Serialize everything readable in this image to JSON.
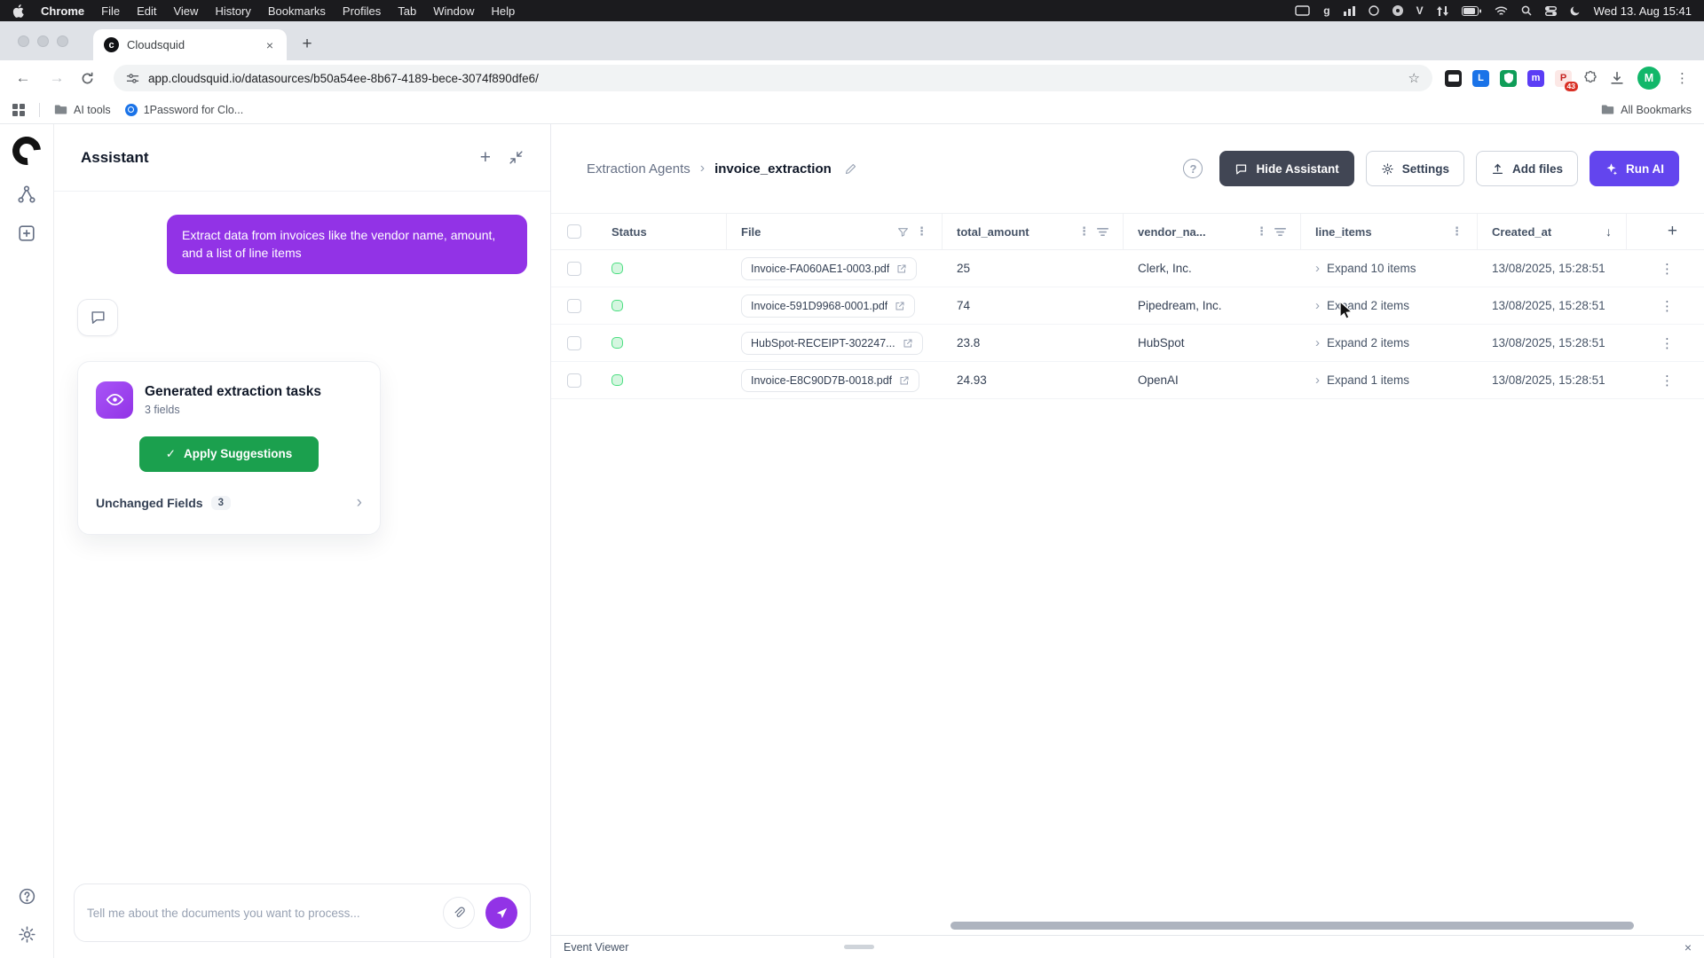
{
  "menubar": {
    "app_name": "Chrome",
    "menus": [
      "File",
      "Edit",
      "View",
      "History",
      "Bookmarks",
      "Profiles",
      "Tab",
      "Window",
      "Help"
    ],
    "clock": "Wed 13. Aug 15:41"
  },
  "browser": {
    "tab_title": "Cloudsquid",
    "url": "app.cloudsquid.io/datasources/b50a54ee-8b67-4189-bece-3074f890dfe6/",
    "ext_badge": "43",
    "avatar_initial": "M",
    "bookmarks_items": [
      "AI tools",
      "1Password for Clo..."
    ],
    "all_bookmarks": "All Bookmarks"
  },
  "assistant": {
    "title": "Assistant",
    "user_message": "Extract data from invoices like the vendor name, amount, and a list of line items",
    "card": {
      "title": "Generated extraction tasks",
      "subtitle": "3 fields",
      "apply_label": "Apply Suggestions",
      "unchanged_label": "Unchanged Fields",
      "unchanged_count": "3"
    },
    "input_placeholder": "Tell me about the documents you want to process..."
  },
  "main": {
    "breadcrumb": {
      "parent": "Extraction Agents",
      "current": "invoice_extraction"
    },
    "actions": {
      "hide_assistant": "Hide Assistant",
      "settings": "Settings",
      "add_files": "Add files",
      "run_ai": "Run AI"
    },
    "table": {
      "columns": {
        "status": "Status",
        "file": "File",
        "total_amount": "total_amount",
        "vendor": "vendor_na...",
        "line_items": "line_items",
        "created_at": "Created_at"
      },
      "rows": [
        {
          "file": "Invoice-FA060AE1-0003.pdf",
          "amount": "25",
          "vendor": "Clerk, Inc.",
          "line_items": "Expand 10 items",
          "created": "13/08/2025, 15:28:51"
        },
        {
          "file": "Invoice-591D9968-0001.pdf",
          "amount": "74",
          "vendor": "Pipedream, Inc.",
          "line_items": "Expand 2 items",
          "created": "13/08/2025, 15:28:51"
        },
        {
          "file": "HubSpot-RECEIPT-302247...",
          "amount": "23.8",
          "vendor": "HubSpot",
          "line_items": "Expand 2 items",
          "created": "13/08/2025, 15:28:51"
        },
        {
          "file": "Invoice-E8C90D7B-0018.pdf",
          "amount": "24.93",
          "vendor": "OpenAI",
          "line_items": "Expand 1 items",
          "created": "13/08/2025, 15:28:51"
        }
      ]
    }
  },
  "event_viewer": {
    "label": "Event Viewer"
  },
  "colors": {
    "accent_purple": "#9233e6",
    "accent_green": "#1ba04e",
    "run_ai": "#6345ee",
    "dark_button": "#414654",
    "status_green": "#4ade80"
  }
}
